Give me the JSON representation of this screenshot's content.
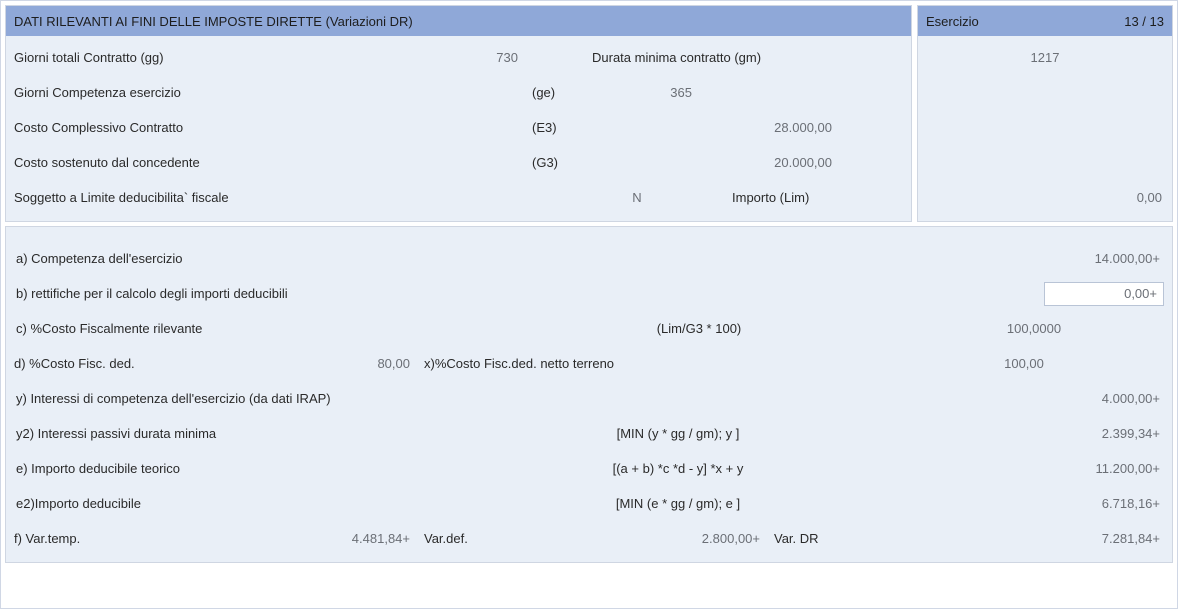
{
  "header": {
    "title": "DATI RILEVANTI AI FINI DELLE IMPOSTE DIRETTE (Variazioni DR)",
    "esercizio_label": "Esercizio",
    "esercizio_value": "13 /   13"
  },
  "top": {
    "r1": {
      "label": "Giorni totali Contratto (gg)",
      "value": "730",
      "label2": "Durata minima contratto (gm)",
      "value2": "1217"
    },
    "r2": {
      "label": "Giorni Competenza esercizio",
      "code": "(ge)",
      "value": "365"
    },
    "r3": {
      "label": "Costo Complessivo Contratto",
      "code": "(E3)",
      "value": "28.000,00"
    },
    "r4": {
      "label": "Costo sostenuto dal concedente",
      "code": "(G3)",
      "value": "20.000,00"
    },
    "r5": {
      "label": "Soggetto a Limite deducibilita` fiscale",
      "value": "N",
      "label2": "Importo (Lim)",
      "value2": "0,00"
    }
  },
  "lower": {
    "a": {
      "label": "a) Competenza dell'esercizio",
      "value": "14.000,00+"
    },
    "b": {
      "label": "b) rettifiche per il calcolo degli importi deducibili",
      "value": "0,00+"
    },
    "c": {
      "label": "c) %Costo Fiscalmente rilevante",
      "formula": "(Lim/G3 * 100)",
      "value": "100,0000"
    },
    "d": {
      "label": "d) %Costo Fisc. ded.",
      "val1": "80,00",
      "label2": "x)%Costo Fisc.ded. netto terreno",
      "val2": "100,00"
    },
    "y": {
      "label": "y) Interessi di competenza dell'esercizio (da dati IRAP)",
      "value": "4.000,00+"
    },
    "y2": {
      "label": "y2) Interessi passivi durata minima",
      "formula": "[MIN (y * gg / gm); y ]",
      "value": "2.399,34+"
    },
    "e": {
      "label": "e) Importo deducibile teorico",
      "formula": "[(a + b) *c *d - y] *x + y",
      "value": "11.200,00+"
    },
    "e2": {
      "label": "e2)Importo deducibile",
      "formula": "[MIN (e * gg / gm); e ]",
      "value": "6.718,16+"
    },
    "f": {
      "label": "f) Var.temp.",
      "val1": "4.481,84+",
      "label2": "Var.def.",
      "val2": "2.800,00+",
      "label3": "Var. DR",
      "val3": "7.281,84+"
    }
  }
}
